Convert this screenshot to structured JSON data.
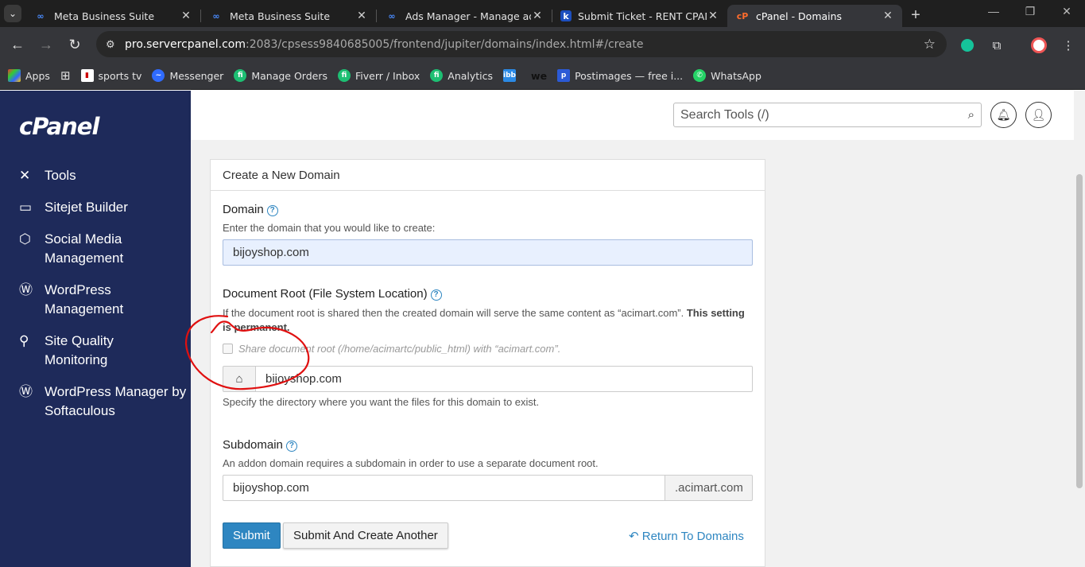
{
  "browser": {
    "tabs": [
      {
        "title": "Meta Business Suite",
        "favicon": "meta-icon"
      },
      {
        "title": "Meta Business Suite",
        "favicon": "meta-icon"
      },
      {
        "title": "Ads Manager - Manage ads",
        "favicon": "meta-icon"
      },
      {
        "title": "Submit Ticket - RENT CPANE",
        "favicon": "k-icon"
      },
      {
        "title": "cPanel - Domains",
        "favicon": "cpanel-icon",
        "active": true
      }
    ],
    "url_host": "pro.servercpanel.com",
    "url_rest": ":2083/cpsess9840685005/frontend/jupiter/domains/index.html#/create",
    "bookmarks": [
      "Apps",
      "sports tv",
      "Messenger",
      "Manage Orders",
      "Fiverr / Inbox",
      "Analytics",
      "Postimages — free i...",
      "WhatsApp"
    ]
  },
  "sidebar": {
    "logo": "cPanel",
    "items": [
      {
        "label": "Tools",
        "icon": "tools-icon"
      },
      {
        "label": "Sitejet Builder",
        "icon": "sitejet-icon"
      },
      {
        "label": "Social Media Management",
        "icon": "social-media-icon"
      },
      {
        "label": "WordPress Management",
        "icon": "wordpress-icon"
      },
      {
        "label": "Site Quality Monitoring",
        "icon": "site-quality-icon"
      },
      {
        "label": "WordPress Manager by Softaculous",
        "icon": "wordpress-icon"
      }
    ]
  },
  "header": {
    "search_placeholder": "Search Tools (/)"
  },
  "form": {
    "panel_title": "Create a New Domain",
    "domain_label": "Domain",
    "domain_hint": "Enter the domain that you would like to create:",
    "domain_value": "bijoyshop.com",
    "docroot_label": "Document Root (File System Location)",
    "docroot_hint": "If the document root is shared then the created domain will serve the same content as “acimart.com”.",
    "docroot_hint_bold": "This setting is permanent.",
    "share_label": "Share document root (/home/acimartc/public_html) with “acimart.com”.",
    "docroot_value": "bijoyshop.com",
    "docroot_help": "Specify the directory where you want the files for this domain to exist.",
    "subdomain_label": "Subdomain",
    "subdomain_hint": "An addon domain requires a subdomain in order to use a separate document root.",
    "subdomain_value": "bijoyshop.com",
    "subdomain_suffix": ".acimart.com",
    "submit_label": "Submit",
    "submit_another_label": "Submit And Create Another",
    "return_label": "Return To Domains"
  }
}
